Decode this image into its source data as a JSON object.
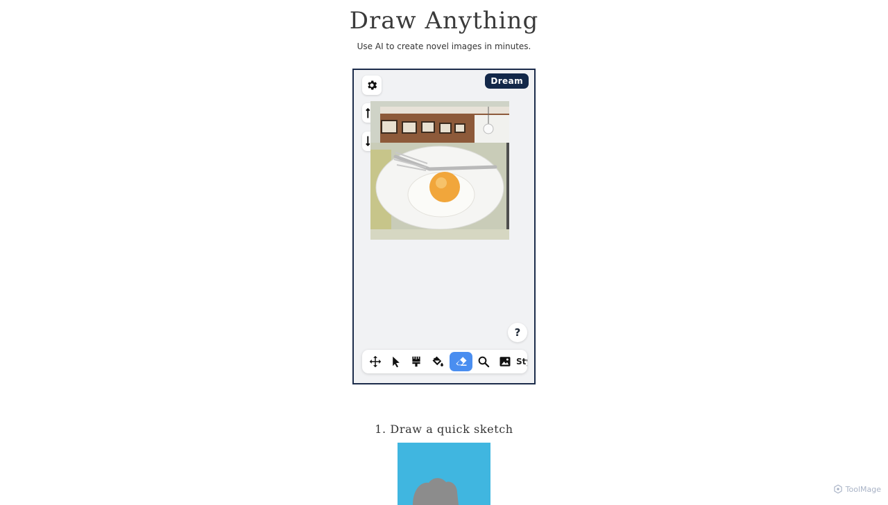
{
  "header": {
    "title": "Draw Anything",
    "subtitle": "Use AI to create novel images in minutes."
  },
  "app": {
    "dream_label": "Dream",
    "help_label": "?",
    "side_buttons": [
      "settings-icon",
      "bring-forward-icon",
      "send-backward-icon"
    ],
    "canvas_image": "fried egg on plate with fork",
    "toolbar": {
      "tools": [
        "move-icon",
        "select-cursor-icon",
        "brush-icon",
        "paint-bucket-icon",
        "eraser-icon",
        "zoom-icon",
        "image-icon"
      ],
      "active_tool": "eraser-icon",
      "style_label": "Sty"
    }
  },
  "steps": [
    {
      "label": "1. Draw a quick sketch"
    }
  ],
  "watermark": {
    "text": "ToolMage"
  },
  "colors": {
    "accent": "#4a8ef0",
    "dream_button": "#132849",
    "frame_border": "#1b2b4a",
    "sketch_bg": "#40b6e0"
  }
}
